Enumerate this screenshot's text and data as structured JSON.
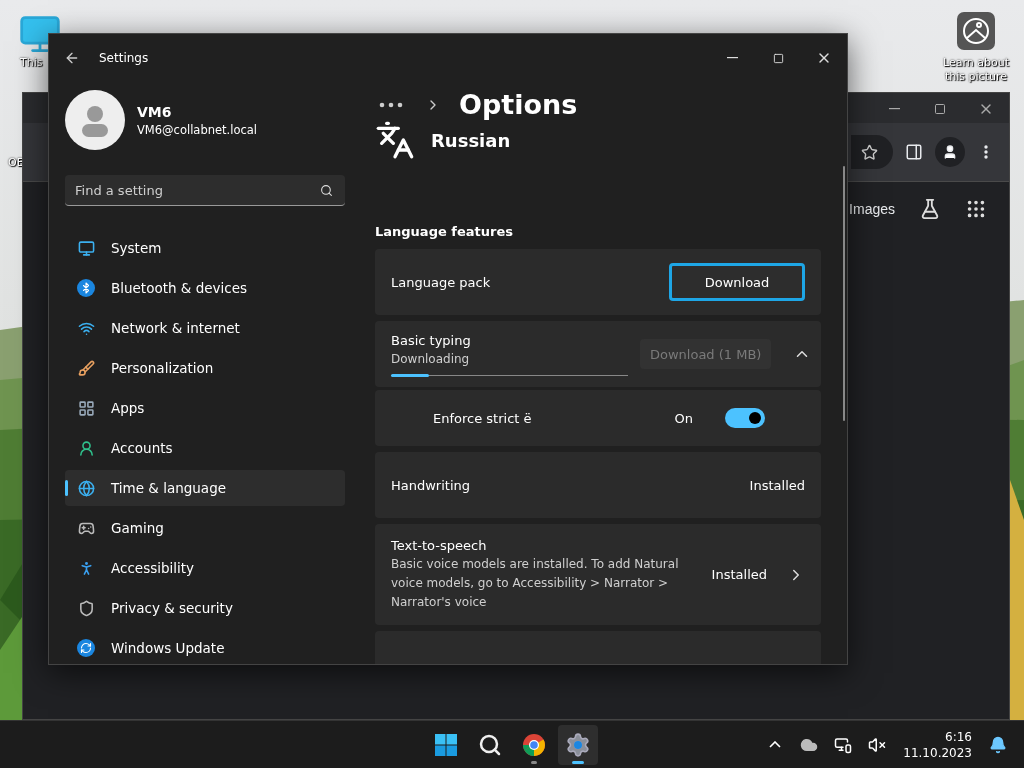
{
  "desktop": {
    "icons": [
      {
        "label": "This"
      },
      {
        "label": "OE"
      }
    ],
    "spotlight": {
      "label": "Learn about this picture"
    }
  },
  "browser": {
    "link": "Images"
  },
  "settings": {
    "title": "Settings",
    "user": {
      "name": "VM6",
      "email": "VM6@collabnet.local"
    },
    "search": {
      "placeholder": "Find a setting"
    },
    "nav": [
      {
        "label": "System",
        "selected": false
      },
      {
        "label": "Bluetooth & devices",
        "selected": false
      },
      {
        "label": "Network & internet",
        "selected": false
      },
      {
        "label": "Personalization",
        "selected": false
      },
      {
        "label": "Apps",
        "selected": false
      },
      {
        "label": "Accounts",
        "selected": false
      },
      {
        "label": "Time & language",
        "selected": true
      },
      {
        "label": "Gaming",
        "selected": false
      },
      {
        "label": "Accessibility",
        "selected": false
      },
      {
        "label": "Privacy & security",
        "selected": false
      },
      {
        "label": "Windows Update",
        "selected": false
      }
    ],
    "page_title": "Options",
    "language": "Russian",
    "section": "Language features",
    "features": [
      {
        "kind": "button",
        "label": "Language pack",
        "button": "Download",
        "focused": true
      },
      {
        "kind": "download",
        "label": "Basic typing",
        "status": "Downloading",
        "level": 0.16,
        "button": "Download (1 MB)",
        "disabled": true,
        "expanded": true,
        "children": [
          {
            "kind": "toggle",
            "label": "Enforce strict ё",
            "state": "On",
            "on": true
          }
        ]
      },
      {
        "kind": "status",
        "label": "Handwriting",
        "status": "Installed"
      },
      {
        "kind": "link",
        "label": "Text-to-speech",
        "description": "Basic voice models are installed. To add Natural voice models, go to Accessibility > Narrator > Narrator's voice",
        "status": "Installed"
      },
      {
        "kind": "blank"
      }
    ]
  },
  "taskbar": {
    "apps": [
      {
        "selected": false
      },
      {
        "selected": false
      },
      {
        "selected": false
      },
      {
        "selected": true
      }
    ],
    "time": "6:16",
    "date": "11.10.2023"
  }
}
